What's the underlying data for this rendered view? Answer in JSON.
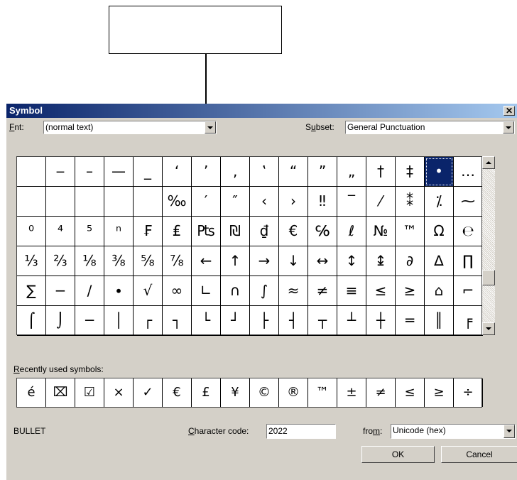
{
  "dialog": {
    "title": "Symbol",
    "close_glyph": "✕"
  },
  "font": {
    "label_prefix": "F",
    "label_underline": "o",
    "label_suffix": "nt:",
    "value": "(normal text)"
  },
  "subset": {
    "label_prefix": "S",
    "label_underline": "u",
    "label_suffix": "bset:",
    "value": "General Punctuation"
  },
  "symbols": [
    " ",
    "‒",
    "–",
    "—",
    "_",
    "‘",
    "’",
    "‚",
    "‛",
    "“",
    "”",
    "„",
    "†",
    "‡",
    "•",
    "…",
    " ",
    " ",
    " ",
    " ",
    " ",
    "‰",
    "′",
    "″",
    "‹",
    "›",
    "‼",
    "‾",
    "⁄",
    "⁑",
    "⁒",
    "⁓",
    "⁰",
    "⁴",
    "⁵",
    "ⁿ",
    "₣",
    "₤",
    "₧",
    "₪",
    "₫",
    "€",
    "℅",
    "ℓ",
    "№",
    "™",
    "Ω",
    "℮",
    "⅓",
    "⅔",
    "⅛",
    "⅜",
    "⅝",
    "⅞",
    "←",
    "↑",
    "→",
    "↓",
    "↔",
    "↕",
    "↨",
    "∂",
    "∆",
    "∏",
    "∑",
    "−",
    "∕",
    "∙",
    "√",
    "∞",
    "∟",
    "∩",
    "∫",
    "≈",
    "≠",
    "≡",
    "≤",
    "≥",
    "⌂",
    "⌐",
    "⌠",
    "⌡",
    "─",
    "│",
    "┌",
    "┐",
    "└",
    "┘",
    "├",
    "┤",
    "┬",
    "┴",
    "┼",
    "═",
    "║",
    "╒"
  ],
  "selected_symbol_index": 14,
  "recent": {
    "label_underline": "R",
    "label_suffix": "ecently used symbols:",
    "items": [
      "é",
      "⌧",
      "☑",
      "×",
      "✓",
      "€",
      "£",
      "¥",
      "©",
      "®",
      "™",
      "±",
      "≠",
      "≤",
      "≥",
      "÷"
    ]
  },
  "char_name": "BULLET",
  "char_code": {
    "label_underline": "C",
    "label_suffix": "haracter code:",
    "value": "2022"
  },
  "from": {
    "label_prefix": "fro",
    "label_underline": "m",
    "label_suffix": ":",
    "value": "Unicode (hex)"
  },
  "buttons": {
    "ok": "OK",
    "cancel": "Cancel"
  }
}
